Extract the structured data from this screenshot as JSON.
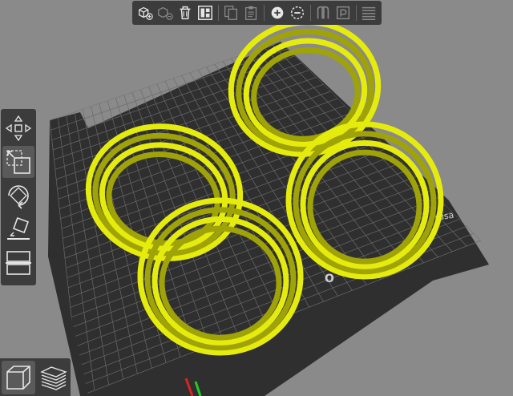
{
  "bed": {
    "brand_text": "rusa",
    "logo_text": "O"
  },
  "colors": {
    "background": "#8a8a8a",
    "bed": "#2f2f2f",
    "grid": "#6e6e6e",
    "model": "#e5ec0d",
    "model_shadow": "#9fa308",
    "toolbar": "#3c3c3c",
    "icon": "#e6e6e6",
    "axis_x": "#d22",
    "axis_y": "#2c2"
  },
  "toolbar_top": {
    "items": [
      {
        "name": "add-icon"
      },
      {
        "name": "delete-icon"
      },
      {
        "name": "delete-all-icon"
      },
      {
        "name": "arrange-icon"
      },
      {
        "name": "copy-icon"
      },
      {
        "name": "paste-icon"
      },
      {
        "name": "instance-add-icon"
      },
      {
        "name": "instance-remove-icon"
      },
      {
        "name": "split-objects-icon"
      },
      {
        "name": "split-parts-icon"
      },
      {
        "name": "layers-editing-icon"
      }
    ]
  },
  "toolbar_left": {
    "items": [
      {
        "name": "move-icon"
      },
      {
        "name": "scale-icon"
      },
      {
        "name": "rotate-icon"
      },
      {
        "name": "place-on-face-icon"
      },
      {
        "name": "cut-icon"
      }
    ]
  },
  "view_toggle": {
    "items": [
      {
        "name": "3d-view-icon"
      },
      {
        "name": "preview-icon"
      }
    ]
  }
}
